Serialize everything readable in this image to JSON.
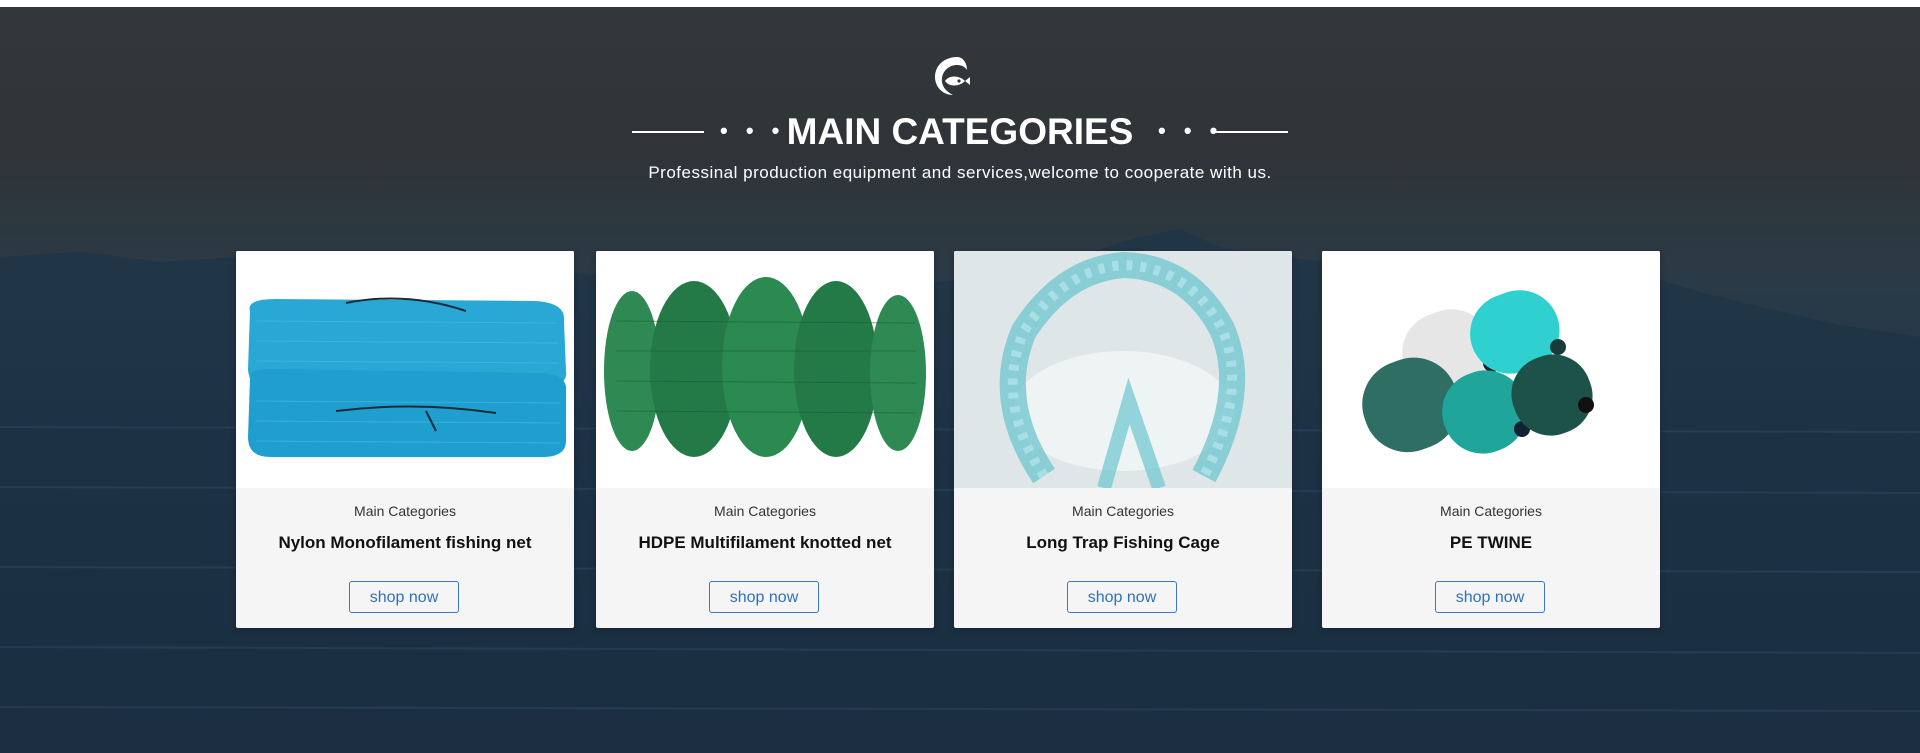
{
  "section": {
    "title": "MAIN CATEGORIES",
    "subtitle": "Professinal production equipment and services,welcome to cooperate with us.",
    "title_decor_dots": "• • •",
    "logo_icon": "fish-icon"
  },
  "cards": [
    {
      "category": "Main Categories",
      "title": "Nylon Monofilament fishing net",
      "button": "shop now",
      "image": "blue-net-bundle"
    },
    {
      "category": "Main Categories",
      "title": "HDPE Multifilament knotted net",
      "button": "shop now",
      "image": "green-net-bundle"
    },
    {
      "category": "Main Categories",
      "title": "Long Trap Fishing Cage",
      "button": "shop now",
      "image": "trap-cage"
    },
    {
      "category": "Main Categories",
      "title": "PE TWINE",
      "button": "shop now",
      "image": "twine-spools"
    }
  ],
  "colors": {
    "button_border": "#3c78c8",
    "button_text": "#2f6fc2",
    "card_bg": "#f5f5f5",
    "heading_text": "#ffffff"
  }
}
